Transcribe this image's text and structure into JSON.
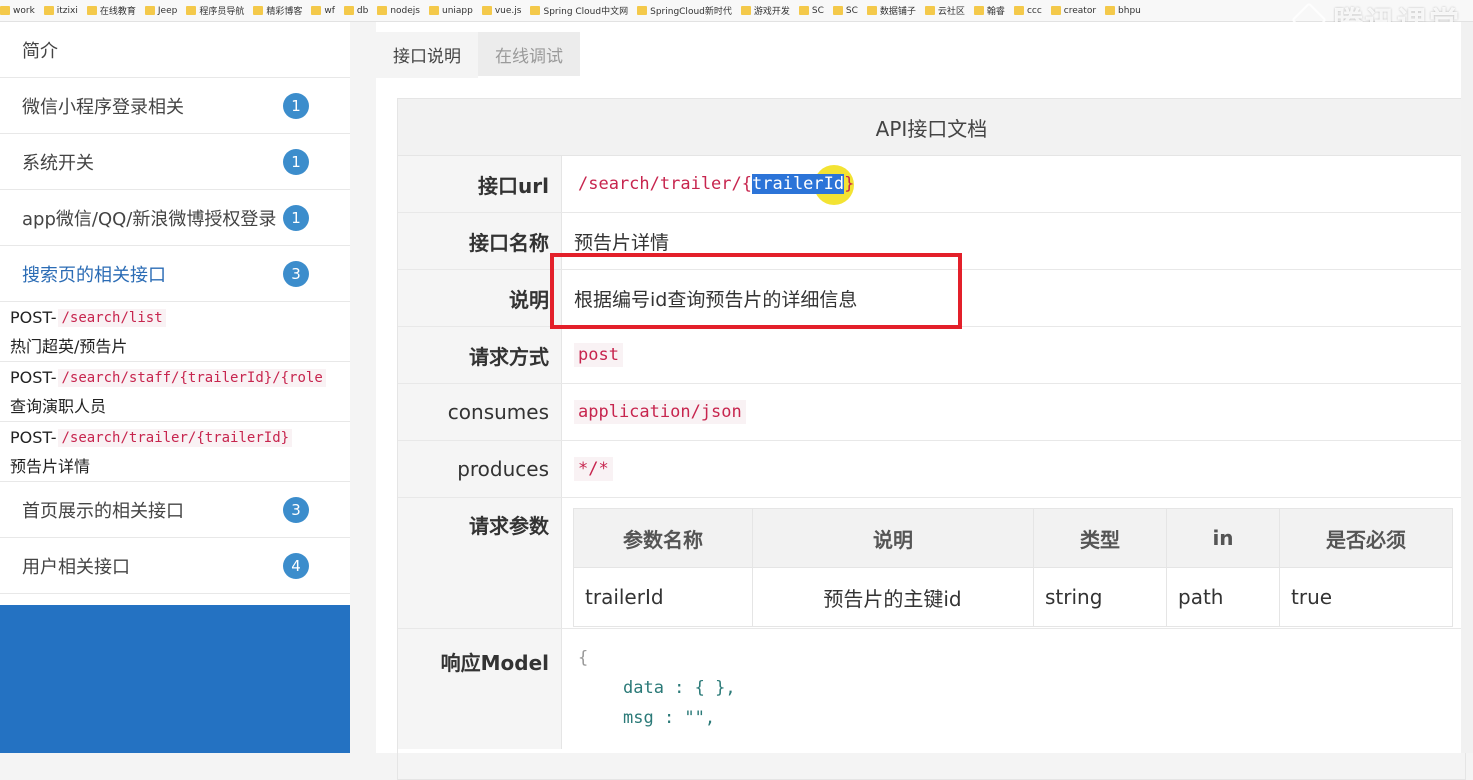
{
  "bookmarks": [
    "work",
    "itzixi",
    "在线教育",
    "Jeep",
    "程序员导航",
    "精彩博客",
    "wf",
    "db",
    "nodejs",
    "uniapp",
    "vue.js",
    "Spring Cloud中文网",
    "SpringCloud新时代",
    "游戏开发",
    "SC",
    "SC",
    "数据铺子",
    "云社区",
    "翰睿",
    "ccc",
    "creator",
    "bhpu"
  ],
  "watermark": "腾讯课堂",
  "sidebar": {
    "intro": "简介",
    "items": [
      {
        "label": "微信小程序登录相关",
        "count": "1"
      },
      {
        "label": "系统开关",
        "count": "1"
      },
      {
        "label": "app微信/QQ/新浪微博授权登录",
        "count": "1"
      },
      {
        "label": "搜索页的相关接口",
        "count": "3"
      }
    ],
    "subitems": [
      {
        "method": "POST-",
        "path": "/search/list",
        "desc": "热门超英/预告片"
      },
      {
        "method": "POST-",
        "path": "/search/staff/{trailerId}/{role",
        "desc": "查询演职人员"
      },
      {
        "method": "POST-",
        "path": "/search/trailer/{trailerId}",
        "desc": "预告片详情"
      }
    ],
    "after": [
      {
        "label": "首页展示的相关接口",
        "count": "3"
      },
      {
        "label": "用户相关接口",
        "count": "4"
      }
    ]
  },
  "tabs": {
    "doc": "接口说明",
    "debug": "在线调试"
  },
  "doc": {
    "title": "API接口文档",
    "url_label": "接口url",
    "url_prefix": "/search/trailer/{",
    "url_selected": "trailerId",
    "url_suffix": "}",
    "name_label": "接口名称",
    "name_value": "预告片详情",
    "desc_label": "说明",
    "desc_value": "根据编号id查询预告片的详细信息",
    "method_label": "请求方式",
    "method_value": "post",
    "consumes_label": "consumes",
    "consumes_value": "application/json",
    "produces_label": "produces",
    "produces_value": "*/*",
    "params_label": "请求参数",
    "params_headers": [
      "参数名称",
      "说明",
      "类型",
      "in",
      "是否必须"
    ],
    "params_rows": [
      [
        "trailerId",
        "预告片的主键id",
        "string",
        "path",
        "true"
      ]
    ],
    "model_label": "响应Model",
    "model_lines": [
      "{",
      "data  : { },",
      "msg  : \"\","
    ]
  },
  "colors": {
    "accent": "#3c8dcc",
    "highlight": "#e3202a",
    "code": "#c7254e",
    "sidebar_bottom": "#2472c2"
  }
}
